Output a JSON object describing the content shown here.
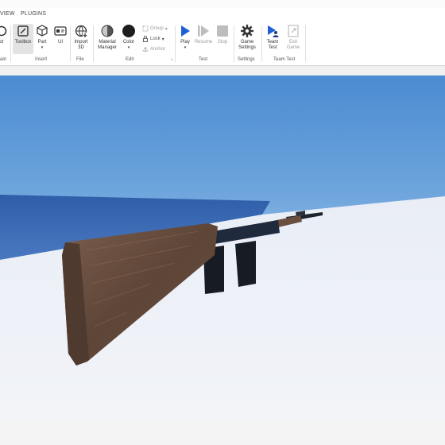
{
  "tabs": {
    "view": "VIEW",
    "plugins": "PLUGINS"
  },
  "ribbon": {
    "cut_tools": {
      "editor_partial": "or",
      "main_partial": "ain"
    },
    "insert": {
      "toolbox": "Toolbox",
      "part": "Part",
      "ui": "UI",
      "label": "Insert"
    },
    "file": {
      "import3d_line1": "Import",
      "import3d_line2": "3D",
      "label": "File"
    },
    "edit": {
      "material_line1": "Material",
      "material_line2": "Manager",
      "color": "Color",
      "group": "Group",
      "lock": "Lock",
      "anchor": "Anchor",
      "label": "Edit"
    },
    "test": {
      "play": "Play",
      "resume": "Resume",
      "stop": "Stop",
      "label": "Test"
    },
    "settings": {
      "game_line1": "Game",
      "game_line2": "Settings",
      "label": "Settings"
    },
    "team_test": {
      "team_line1": "Team",
      "team_line2": "Test",
      "exit_line1": "Exit",
      "exit_line2": "Game",
      "label": "Team Test"
    }
  },
  "colors": {
    "accent": "#1f5fd6",
    "wood": "#6a4e3f",
    "metal": "#1d2430",
    "sky": "#4b8bd1",
    "snow": "#e9edf6"
  }
}
